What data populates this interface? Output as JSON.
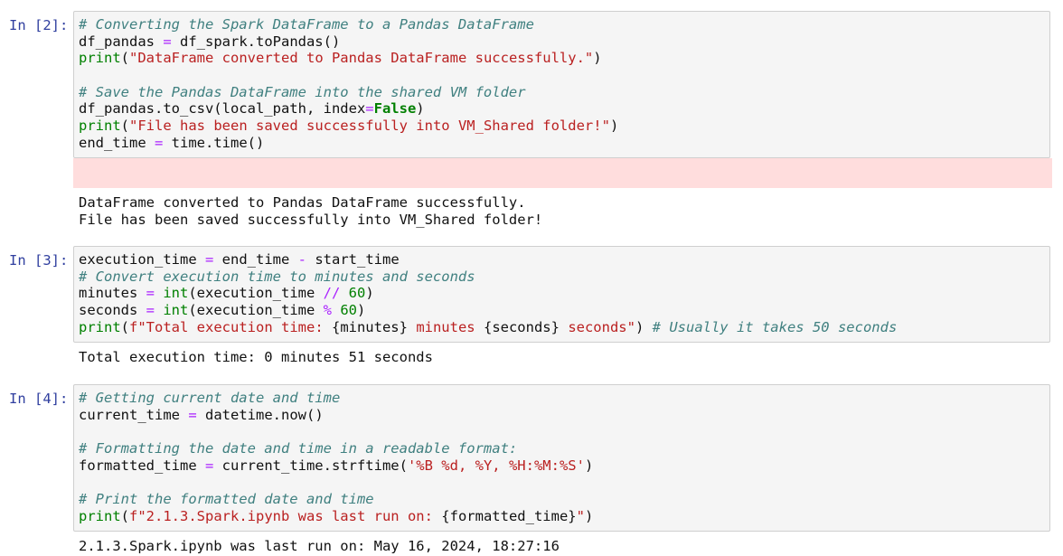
{
  "cells": [
    {
      "prompt": "In [2]:",
      "lines": [
        [
          {
            "t": "# Converting the Spark DataFrame to a Pandas DataFrame",
            "c": "c"
          }
        ],
        [
          {
            "t": "df_pandas ",
            "c": ""
          },
          {
            "t": "=",
            "c": "o"
          },
          {
            "t": " df_spark.toPandas()",
            "c": ""
          }
        ],
        [
          {
            "t": "print",
            "c": "k"
          },
          {
            "t": "(",
            "c": ""
          },
          {
            "t": "\"DataFrame converted to Pandas DataFrame successfully.\"",
            "c": "s"
          },
          {
            "t": ")",
            "c": ""
          }
        ],
        [
          {
            "t": "",
            "c": ""
          }
        ],
        [
          {
            "t": "# Save the Pandas DataFrame into the shared VM folder",
            "c": "c"
          }
        ],
        [
          {
            "t": "df_pandas.to_csv(local_path, index",
            "c": ""
          },
          {
            "t": "=",
            "c": "o"
          },
          {
            "t": "False",
            "c": "kb"
          },
          {
            "t": ")",
            "c": ""
          }
        ],
        [
          {
            "t": "print",
            "c": "k"
          },
          {
            "t": "(",
            "c": ""
          },
          {
            "t": "\"File has been saved successfully into VM_Shared folder!\"",
            "c": "s"
          },
          {
            "t": ")",
            "c": ""
          }
        ],
        [
          {
            "t": "end_time ",
            "c": ""
          },
          {
            "t": "=",
            "c": "o"
          },
          {
            "t": " time.time()",
            "c": ""
          }
        ]
      ],
      "output": [
        "DataFrame converted to Pandas DataFrame successfully.",
        "File has been saved successfully into VM_Shared folder!"
      ]
    },
    {
      "prompt": "In [3]:",
      "lines": [
        [
          {
            "t": "execution_time ",
            "c": ""
          },
          {
            "t": "=",
            "c": "o"
          },
          {
            "t": " end_time ",
            "c": ""
          },
          {
            "t": "-",
            "c": "o"
          },
          {
            "t": " start_time",
            "c": ""
          }
        ],
        [
          {
            "t": "# Convert execution time to minutes and seconds",
            "c": "c"
          }
        ],
        [
          {
            "t": "minutes ",
            "c": ""
          },
          {
            "t": "=",
            "c": "o"
          },
          {
            "t": " ",
            "c": ""
          },
          {
            "t": "int",
            "c": "k"
          },
          {
            "t": "(execution_time ",
            "c": ""
          },
          {
            "t": "//",
            "c": "o"
          },
          {
            "t": " ",
            "c": ""
          },
          {
            "t": "60",
            "c": "num"
          },
          {
            "t": ")",
            "c": ""
          }
        ],
        [
          {
            "t": "seconds ",
            "c": ""
          },
          {
            "t": "=",
            "c": "o"
          },
          {
            "t": " ",
            "c": ""
          },
          {
            "t": "int",
            "c": "k"
          },
          {
            "t": "(execution_time ",
            "c": ""
          },
          {
            "t": "%",
            "c": "o"
          },
          {
            "t": " ",
            "c": ""
          },
          {
            "t": "60",
            "c": "num"
          },
          {
            "t": ")",
            "c": ""
          }
        ],
        [
          {
            "t": "print",
            "c": "k"
          },
          {
            "t": "(",
            "c": ""
          },
          {
            "t": "f\"Total execution time: ",
            "c": "s"
          },
          {
            "t": "{minutes}",
            "c": "si"
          },
          {
            "t": " minutes ",
            "c": "s"
          },
          {
            "t": "{seconds}",
            "c": "si"
          },
          {
            "t": " seconds\"",
            "c": "s"
          },
          {
            "t": ") ",
            "c": ""
          },
          {
            "t": "# Usually it takes 50 seconds",
            "c": "c"
          }
        ]
      ],
      "output": [
        "Total execution time: 0 minutes 51 seconds"
      ]
    },
    {
      "prompt": "In [4]:",
      "lines": [
        [
          {
            "t": "# Getting current date and time",
            "c": "c"
          }
        ],
        [
          {
            "t": "current_time ",
            "c": ""
          },
          {
            "t": "=",
            "c": "o"
          },
          {
            "t": " datetime.now()",
            "c": ""
          }
        ],
        [
          {
            "t": "",
            "c": ""
          }
        ],
        [
          {
            "t": "# Formatting the date and time in a readable format:",
            "c": "c"
          }
        ],
        [
          {
            "t": "formatted_time ",
            "c": ""
          },
          {
            "t": "=",
            "c": "o"
          },
          {
            "t": " current_time.strftime(",
            "c": ""
          },
          {
            "t": "'%B %d, %Y, %H:%M:%S'",
            "c": "s"
          },
          {
            "t": ")",
            "c": ""
          }
        ],
        [
          {
            "t": "",
            "c": ""
          }
        ],
        [
          {
            "t": "# Print the formatted date and time",
            "c": "c"
          }
        ],
        [
          {
            "t": "print",
            "c": "k"
          },
          {
            "t": "(",
            "c": ""
          },
          {
            "t": "f\"2.1.3.Spark.ipynb was last run on: ",
            "c": "s"
          },
          {
            "t": "{formatted_time}",
            "c": "si"
          },
          {
            "t": "\"",
            "c": "s"
          },
          {
            "t": ")",
            "c": ""
          }
        ]
      ],
      "output": [
        "2.1.3.Spark.ipynb was last run on: May 16, 2024, 18:27:16"
      ]
    }
  ]
}
